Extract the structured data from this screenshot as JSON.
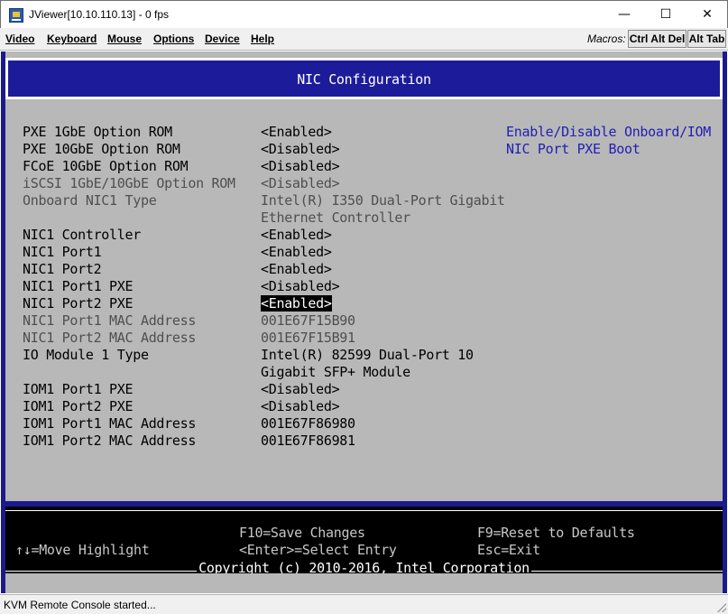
{
  "window": {
    "title": "JViewer[10.10.110.13] - 0 fps",
    "minimize_glyph": "—",
    "maximize_glyph": "☐",
    "close_glyph": "✕"
  },
  "menu": {
    "items": [
      "Video",
      "Keyboard",
      "Mouse",
      "Options",
      "Device",
      "Help"
    ],
    "macros_label": "Macros:",
    "macro_buttons": [
      "Ctrl Alt Del",
      "Alt Tab"
    ]
  },
  "bios": {
    "page_title": "NIC Configuration",
    "rows": [
      {
        "label": "PXE 1GbE Option ROM",
        "value": "<Enabled>"
      },
      {
        "label": "PXE 10GbE Option ROM",
        "value": "<Disabled>"
      },
      {
        "label": "FCoE 10GbE Option ROM",
        "value": "<Disabled>"
      },
      {
        "label": "iSCSI 1GbE/10GbE Option ROM",
        "value": "<Disabled>"
      },
      {
        "label": "Onboard NIC1 Type",
        "value": "Intel(R) I350 Dual-Port Gigabit",
        "value_cont": "Ethernet Controller"
      },
      {
        "label": "NIC1 Controller",
        "value": "<Enabled>"
      },
      {
        "label": "NIC1 Port1",
        "value": "<Enabled>"
      },
      {
        "label": "NIC1 Port2",
        "value": "<Enabled>"
      },
      {
        "label": "NIC1 Port1 PXE",
        "value": "<Disabled>"
      },
      {
        "label": "NIC1 Port2 PXE",
        "value": "<Enabled>"
      },
      {
        "label": "NIC1 Port1 MAC Address",
        "value": "001E67F15B90"
      },
      {
        "label": "NIC1 Port2 MAC Address",
        "value": "001E67F15B91"
      },
      {
        "label": "IO Module 1 Type",
        "value": "Intel(R) 82599 Dual-Port 10",
        "value_cont": "Gigabit SFP+ Module"
      },
      {
        "label": "IOM1 Port1 PXE",
        "value": "<Disabled>"
      },
      {
        "label": "IOM1 Port2 PXE",
        "value": "<Disabled>"
      },
      {
        "label": "IOM1 Port1 MAC Address",
        "value": "001E67F86980"
      },
      {
        "label": "IOM1 Port2 MAC Address",
        "value": "001E67F86981"
      }
    ],
    "help": {
      "line1": "Enable/Disable Onboard/IOM",
      "line2": "NIC Port PXE Boot"
    },
    "footer": {
      "save": "F10=Save Changes",
      "reset": "F9=Reset to Defaults",
      "move": "↑↓=Move Highlight",
      "select": "<Enter>=Select Entry",
      "exit": "Esc=Exit",
      "copyright": "Copyright (c) 2010-2016, Intel Corporation"
    }
  },
  "status": {
    "text": "KVM Remote Console started..."
  },
  "colors": {
    "bios_background": "#b8b8b8",
    "bios_blue": "#1c1c9a",
    "help_text": "#1f1fb4",
    "highlight_bg": "#000000",
    "highlight_fg": "#ffffff"
  }
}
